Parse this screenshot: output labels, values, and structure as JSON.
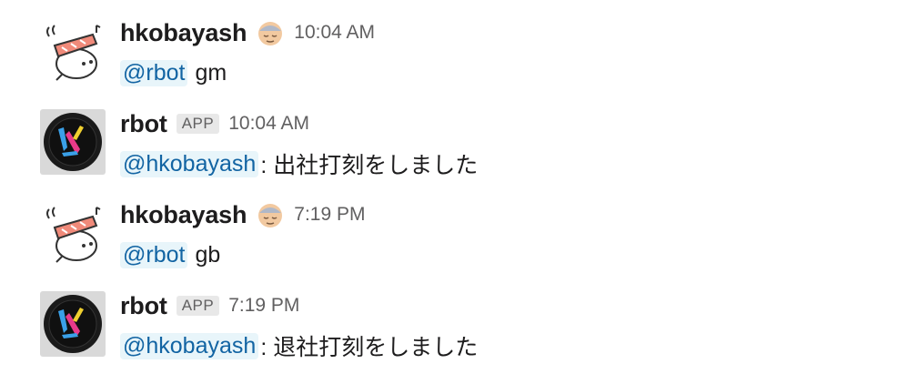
{
  "messages": [
    {
      "username": "hkobayash",
      "kind": "user",
      "status_icon": "old-man-emoji-icon",
      "timestamp": "10:04 AM",
      "mention": "@rbot",
      "text": "gm"
    },
    {
      "username": "rbot",
      "kind": "bot",
      "badge": "APP",
      "timestamp": "10:04 AM",
      "mention": "@hkobayash",
      "text": ": 出社打刻をしました"
    },
    {
      "username": "hkobayash",
      "kind": "user",
      "status_icon": "old-man-emoji-icon",
      "timestamp": "7:19 PM",
      "mention": "@rbot",
      "text": "gb"
    },
    {
      "username": "rbot",
      "kind": "bot",
      "badge": "APP",
      "timestamp": "7:19 PM",
      "mention": "@hkobayash",
      "text": ": 退社打刻をしました"
    }
  ],
  "colors": {
    "mention_text": "#1264a3",
    "mention_bg": "#e8f5fa",
    "timestamp": "#616061",
    "badge_bg": "#e8e8e8"
  }
}
